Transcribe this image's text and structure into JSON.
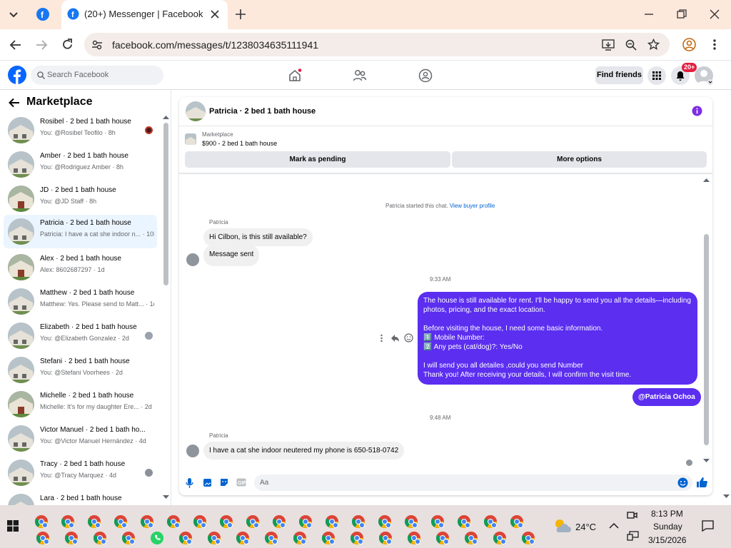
{
  "browser": {
    "tab_title": "(20+) Messenger | Facebook",
    "url": "facebook.com/messages/t/1238034635111941"
  },
  "fb_header": {
    "search_placeholder": "Search Facebook",
    "find_friends": "Find friends",
    "notification_badge": "20+"
  },
  "sidebar": {
    "title": "Marketplace",
    "conversations": [
      {
        "name": "Rosibel · 2 bed 1 bath house",
        "preview": "You: @Rosibel Teofilo · 8h"
      },
      {
        "name": "Amber · 2 bed 1 bath house",
        "preview": "You: @Rodriguez Amber · 8h"
      },
      {
        "name": "JD · 2 bed 1 bath house",
        "preview": "You: @JD Staff · 8h"
      },
      {
        "name": "Patricia · 2 bed 1 bath house",
        "preview": "Patricia: I have a cat she indoor n... · 10h"
      },
      {
        "name": "Alex · 2 bed 1 bath house",
        "preview": "Alex: 8602687297 · 1d"
      },
      {
        "name": "Matthew · 2 bed 1 bath house",
        "preview": "Matthew: Yes. Please send to Matt... · 1d"
      },
      {
        "name": "Elizabeth · 2 bed 1 bath house",
        "preview": "You: @Elizabeth Gonzalez · 2d"
      },
      {
        "name": "Stefani · 2 bed 1 bath house",
        "preview": "You: @Stefani Voorhees · 2d"
      },
      {
        "name": "Michelle · 2 bed 1 bath house",
        "preview": "Michelle: It's for my daughter Ere... · 2d"
      },
      {
        "name": "Victor Manuel · 2 bed 1 bath ho...",
        "preview": "You: @Victor Manuel Hernández · 4d"
      },
      {
        "name": "Tracy · 2 bed 1 bath house",
        "preview": "You: @Tracy Marquez · 4d"
      },
      {
        "name": "Lara · 2 bed 1 bath house",
        "preview": ""
      }
    ]
  },
  "chat": {
    "title": "Patricia · 2 bed 1 bath house",
    "listing_source": "Marketplace",
    "listing_price": "$900 - 2 bed 1 bath house",
    "mark_pending": "Mark as pending",
    "more_options": "More options",
    "started_text": "Patricia started this chat.",
    "view_profile": "View buyer profile",
    "sender_name": "Patricia",
    "msg1": "Hi Cilbon, is this still available?",
    "msg2": "Message sent",
    "time1": "9:33 AM",
    "reply_lines": [
      "The house is still available for rent. I'll be happy to send you all the details—including",
      "photos, pricing, and the exact location.",
      "",
      "Before visiting the house, I need some basic information.",
      "1️⃣  Mobile Number:",
      "2️⃣  Any pets (cat/dog)?: Yes/No",
      "",
      "I will send you all detailes ,could you send Number",
      "Thank you! After receiving your details, I will confirm the visit time."
    ],
    "mention": "@Patricia Ochoa",
    "time2": "9:48 AM",
    "msg3": "I have a cat she indoor neutered my phone is 650-518-0742",
    "composer_placeholder": "Aa"
  },
  "taskbar": {
    "weather_temp": "24°C",
    "time": "8:13 PM",
    "day": "Sunday",
    "date": "3/15/2026"
  }
}
